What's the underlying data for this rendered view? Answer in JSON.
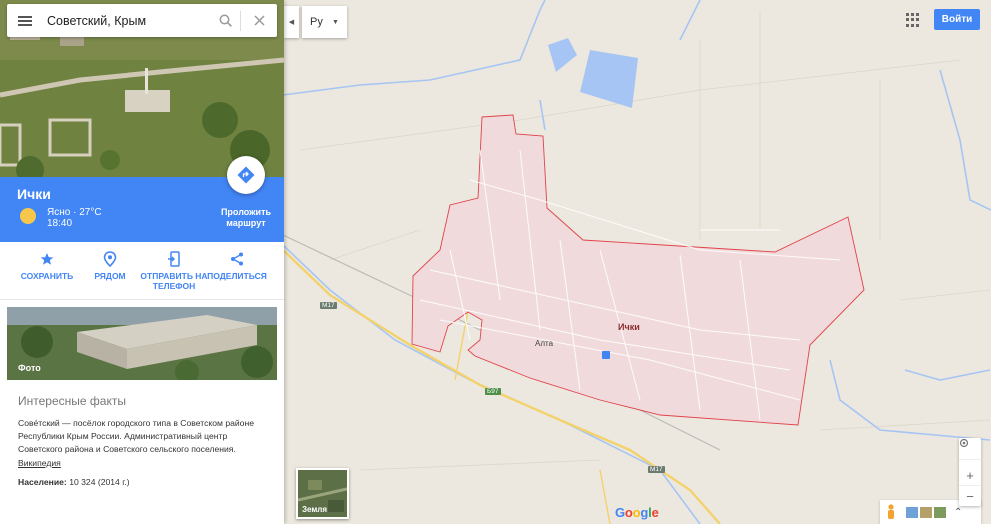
{
  "search": {
    "query": "Советский, Крым"
  },
  "place": {
    "name": "Ички",
    "weather": "Ясно · 27°C",
    "time": "18:40",
    "route_label": "Проложить маршрут"
  },
  "actions": [
    {
      "label": "СОХРАНИТЬ",
      "icon": "star-icon"
    },
    {
      "label": "РЯДОМ",
      "icon": "location-icon"
    },
    {
      "label": "ОТПРАВИТЬ НА ТЕЛЕФОН",
      "icon": "send-to-phone-icon"
    },
    {
      "label": "ПОДЕЛИТЬСЯ",
      "icon": "share-icon"
    }
  ],
  "photo_label": "Фото",
  "facts": {
    "heading": "Интересные факты",
    "text": "Сове́тский — посёлок городского типа в Советском районе Республики Крым России. Административный центр Советского района и Советского сельского поселения.",
    "wiki_link": "Википедия",
    "population_label": "Население:",
    "population_value": "10 324 (2014 г.)"
  },
  "language": {
    "code": "Ру"
  },
  "signin_label": "Войти",
  "map": {
    "town_label": "Ички",
    "poi_label": "Алта",
    "roads": [
      "M17",
      "M17",
      "Б97"
    ],
    "earth_label": "Земля",
    "google_logo": "Google"
  },
  "colors": {
    "blue": "#4285f4",
    "boundary": "#e0434a",
    "town_fill": "#f1d8da",
    "water": "#a6c5f4"
  }
}
